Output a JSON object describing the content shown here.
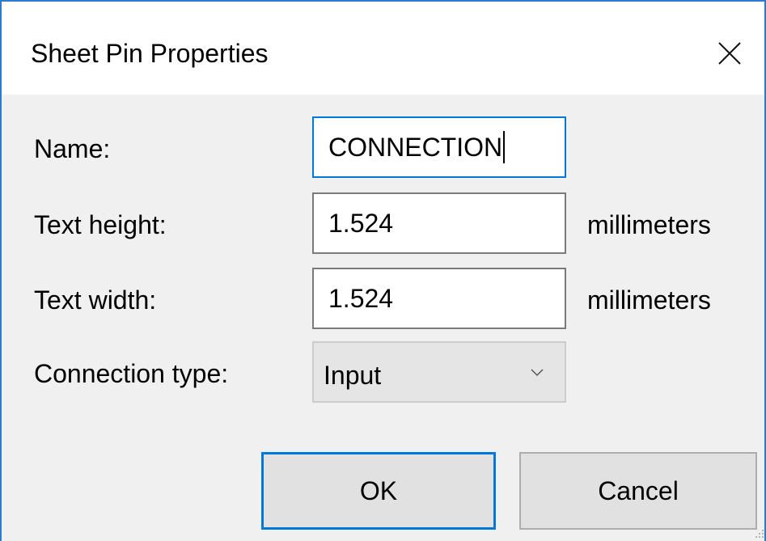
{
  "window": {
    "title": "Sheet Pin Properties",
    "close_icon": "close-icon"
  },
  "form": {
    "name": {
      "label": "Name:",
      "value": "CONNECTION"
    },
    "text_height": {
      "label": "Text height:",
      "value": "1.524",
      "units": "millimeters"
    },
    "text_width": {
      "label": "Text width:",
      "value": "1.524",
      "units": "millimeters"
    },
    "connection_type": {
      "label": "Connection type:",
      "selected": "Input",
      "icon": "chevron-down-icon"
    }
  },
  "buttons": {
    "ok": "OK",
    "cancel": "Cancel"
  },
  "colors": {
    "accent": "#0078d7",
    "window_border": "#2b7bd3",
    "dialog_background": "#f0f0f0"
  }
}
